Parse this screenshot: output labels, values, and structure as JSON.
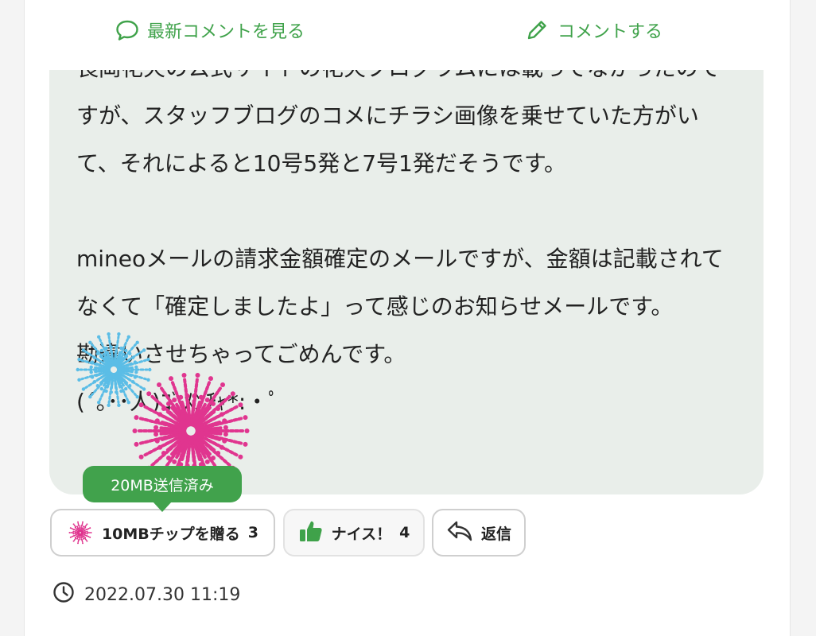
{
  "header": {
    "latest_comments_label": "最新コメントを見る",
    "comment_label": "コメントする"
  },
  "comment": {
    "body": "長岡花火の公式サイトの花火プログラムには載ってなかったのですが、スタッフブログのコメにチラシ画像を乗せていた方がいて、それによると10号5発と7号1発だそうです。\n\nmineoメールの請求金額確定のメールですが、金額は記載されてなくて「確定しましたよ」って感じのお知らせメールです。\n勘違いさせちゃってごめんです。\n(´｡･･人)ｺﾞﾒﾝﾁｬ*:・ﾟ"
  },
  "tooltip": {
    "label": "20MB送信済み"
  },
  "actions": {
    "chip_label": "10MBチップを贈る",
    "chip_count": "3",
    "nice_label": "ナイス！",
    "nice_count": "4",
    "reply_label": "返信"
  },
  "meta": {
    "timestamp": "2022.07.30 11:19"
  },
  "colors": {
    "accent_green": "#3fa24a",
    "firework_pink": "#e0358f",
    "firework_blue": "#5bbde6"
  }
}
